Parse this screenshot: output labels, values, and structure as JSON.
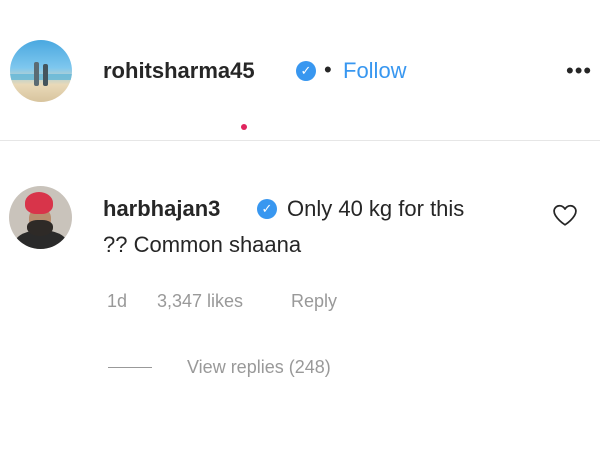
{
  "post": {
    "owner_username": "rohitsharma45",
    "separator": "•",
    "follow_label": "Follow",
    "more_label": "•••"
  },
  "comment": {
    "username": "harbhajan3",
    "text_line1": "Only 40 kg for this",
    "text_line2": "?? Common shaana",
    "time": "1d",
    "likes": "3,347 likes",
    "reply_label": "Reply",
    "view_replies_label": "View replies (248)"
  },
  "icons": {
    "verified": "verified-badge-icon",
    "heart": "heart-outline-icon",
    "more": "more-options-icon"
  },
  "colors": {
    "link_blue": "#3897f0",
    "text": "#262626",
    "muted": "#999999",
    "notification_red": "#e0245e"
  }
}
